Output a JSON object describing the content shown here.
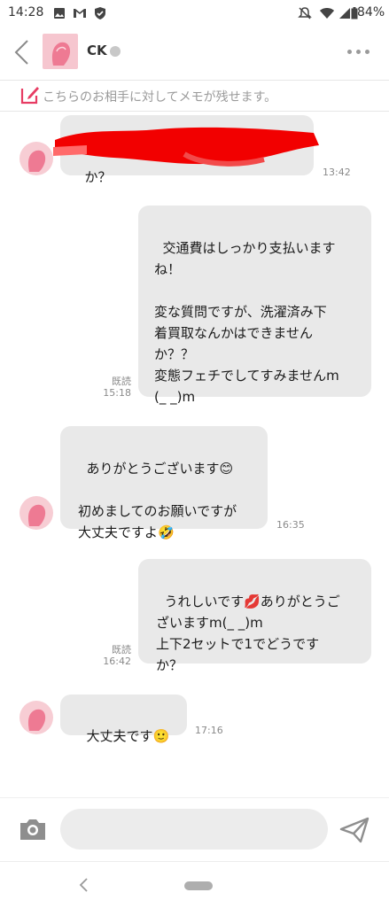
{
  "status_bar": {
    "time": "14:28",
    "battery": "84%"
  },
  "header": {
    "contact_name": "CK"
  },
  "memo": {
    "placeholder": "こちらのお相手に対してメモが残せます。"
  },
  "messages": [
    {
      "side": "received",
      "text": "か？",
      "time": "13:42",
      "redacted": true
    },
    {
      "side": "sent",
      "text": "交通費はしっかり支払います\nね！\n\n変な質問ですが、洗濯済み下\n着買取なんかはできません\nか？？\n変態フェチでしてすみませんm\n(_ _)m",
      "read": "既読",
      "time": "15:18"
    },
    {
      "side": "received",
      "text": "ありがとうございます😊\n\n初めましてのお願いですが\n大丈夫ですよ🤣",
      "time": "16:35"
    },
    {
      "side": "sent",
      "text": "うれしいです💋ありがとうご\nざいますm(_ _)m\n上下2セットで1でどうです\nか？",
      "read": "既読",
      "time": "16:42"
    },
    {
      "side": "received",
      "text": "大丈夫です🙂",
      "time": "17:16"
    }
  ],
  "input": {
    "placeholder": ""
  },
  "colors": {
    "accent": "#e73c63",
    "bubble": "#e9e9e9",
    "avatar": "#f7cdd4"
  }
}
